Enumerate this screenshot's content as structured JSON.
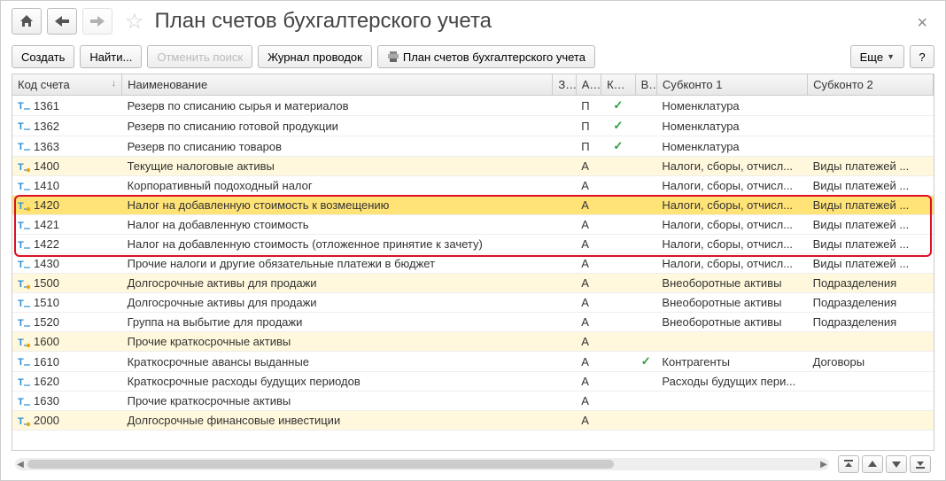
{
  "window": {
    "title": "План счетов бухгалтерского учета"
  },
  "toolbar": {
    "create": "Создать",
    "find": "Найти...",
    "cancel_search": "Отменить поиск",
    "journal": "Журнал проводок",
    "print_label": "План счетов бухгалтерского учета",
    "more": "Еще",
    "help": "?"
  },
  "columns": {
    "code": "Код счета",
    "name": "Наименование",
    "z": "З...",
    "a": "А...",
    "kol": "Кол.",
    "v": "В.",
    "sub1": "Субконто 1",
    "sub2": "Субконто 2"
  },
  "rows": [
    {
      "code": "1361",
      "name": "Резерв по списанию сырья и материалов",
      "a": "П",
      "kol": "✓",
      "sub1": "Номенклатура",
      "sub2": "",
      "group": false,
      "selected": false,
      "gicon": false
    },
    {
      "code": "1362",
      "name": "Резерв по списанию готовой продукции",
      "a": "П",
      "kol": "✓",
      "sub1": "Номенклатура",
      "sub2": "",
      "group": false,
      "selected": false,
      "gicon": false
    },
    {
      "code": "1363",
      "name": "Резерв по списанию товаров",
      "a": "П",
      "kol": "✓",
      "sub1": "Номенклатура",
      "sub2": "",
      "group": false,
      "selected": false,
      "gicon": false
    },
    {
      "code": "1400",
      "name": "Текущие налоговые активы",
      "a": "А",
      "kol": "",
      "sub1": "Налоги, сборы, отчисл...",
      "sub2": "Виды платежей ...",
      "group": true,
      "selected": false,
      "gicon": true
    },
    {
      "code": "1410",
      "name": "Корпоративный подоходный налог",
      "a": "А",
      "kol": "",
      "sub1": "Налоги, сборы, отчисл...",
      "sub2": "Виды платежей ...",
      "group": false,
      "selected": false,
      "gicon": false
    },
    {
      "code": "1420",
      "name": "Налог на добавленную стоимость к возмещению",
      "a": "А",
      "kol": "",
      "sub1": "Налоги, сборы, отчисл...",
      "sub2": "Виды платежей ...",
      "group": true,
      "selected": true,
      "gicon": true
    },
    {
      "code": "1421",
      "name": "Налог на добавленную стоимость",
      "a": "А",
      "kol": "",
      "sub1": "Налоги, сборы, отчисл...",
      "sub2": "Виды платежей ...",
      "group": false,
      "selected": false,
      "gicon": false
    },
    {
      "code": "1422",
      "name": "Налог на добавленную стоимость (отложенное принятие к зачету)",
      "a": "А",
      "kol": "",
      "sub1": "Налоги, сборы, отчисл...",
      "sub2": "Виды платежей ...",
      "group": false,
      "selected": false,
      "gicon": false
    },
    {
      "code": "1430",
      "name": "Прочие налоги и другие обязательные платежи в бюджет",
      "a": "А",
      "kol": "",
      "sub1": "Налоги, сборы, отчисл...",
      "sub2": "Виды платежей ...",
      "group": false,
      "selected": false,
      "gicon": false
    },
    {
      "code": "1500",
      "name": "Долгосрочные активы для продажи",
      "a": "А",
      "kol": "",
      "sub1": "Внеоборотные активы",
      "sub2": "Подразделения",
      "group": true,
      "selected": false,
      "gicon": true
    },
    {
      "code": "1510",
      "name": "Долгосрочные активы для продажи",
      "a": "А",
      "kol": "",
      "sub1": "Внеоборотные активы",
      "sub2": "Подразделения",
      "group": false,
      "selected": false,
      "gicon": false
    },
    {
      "code": "1520",
      "name": "Группа на выбытие для продажи",
      "a": "А",
      "kol": "",
      "sub1": "Внеоборотные активы",
      "sub2": "Подразделения",
      "group": false,
      "selected": false,
      "gicon": false
    },
    {
      "code": "1600",
      "name": "Прочие краткосрочные активы",
      "a": "А",
      "kol": "",
      "sub1": "",
      "sub2": "",
      "group": true,
      "selected": false,
      "gicon": true
    },
    {
      "code": "1610",
      "name": "Краткосрочные авансы выданные",
      "a": "А",
      "kol": "",
      "v": "✓",
      "sub1": "Контрагенты",
      "sub2": "Договоры",
      "group": false,
      "selected": false,
      "gicon": false
    },
    {
      "code": "1620",
      "name": "Краткосрочные расходы будущих периодов",
      "a": "А",
      "kol": "",
      "sub1": "Расходы будущих пери...",
      "sub2": "",
      "group": false,
      "selected": false,
      "gicon": false
    },
    {
      "code": "1630",
      "name": "Прочие краткосрочные активы",
      "a": "А",
      "kol": "",
      "sub1": "",
      "sub2": "",
      "group": false,
      "selected": false,
      "gicon": false
    },
    {
      "code": "2000",
      "name": "Долгосрочные финансовые инвестиции",
      "a": "А",
      "kol": "",
      "sub1": "",
      "sub2": "",
      "group": true,
      "selected": false,
      "gicon": true,
      "clipped": true
    }
  ]
}
